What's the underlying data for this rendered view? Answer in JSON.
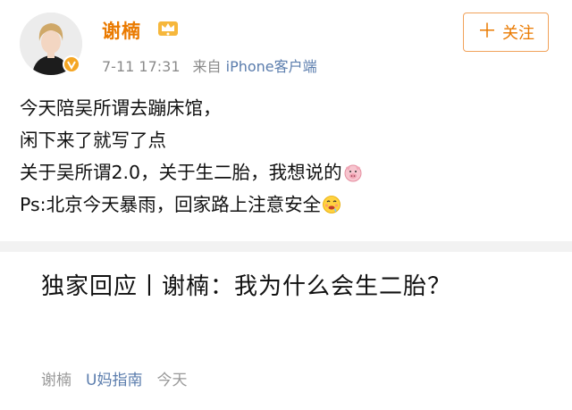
{
  "post": {
    "author": "谢楠",
    "time": "7-11 17:31",
    "source_prefix": "来自",
    "source": "iPhone客户端",
    "follow_label": "关注",
    "lines": [
      "今天陪吴所谓去蹦床馆，",
      "闲下来了就写了点",
      "关于吴所谓2.0，关于生二胎，我想说的",
      "Ps:北京今天暴雨，回家路上注意安全"
    ],
    "icons": {
      "verified": "verified-badge-icon",
      "member": "crown-icon",
      "pig": "pig-face-emoji",
      "drool": "drooling-face-emoji"
    }
  },
  "card": {
    "title": "独家回应丨谢楠：我为什么会生二胎？",
    "author": "谢楠",
    "channel": "U妈指南",
    "time": "今天"
  },
  "colors": {
    "name": "#ea7a00",
    "follow_border": "#f1a25a",
    "link": "#5b7dad",
    "meta": "#8a8a8a",
    "divider": "#f2f2f2"
  }
}
